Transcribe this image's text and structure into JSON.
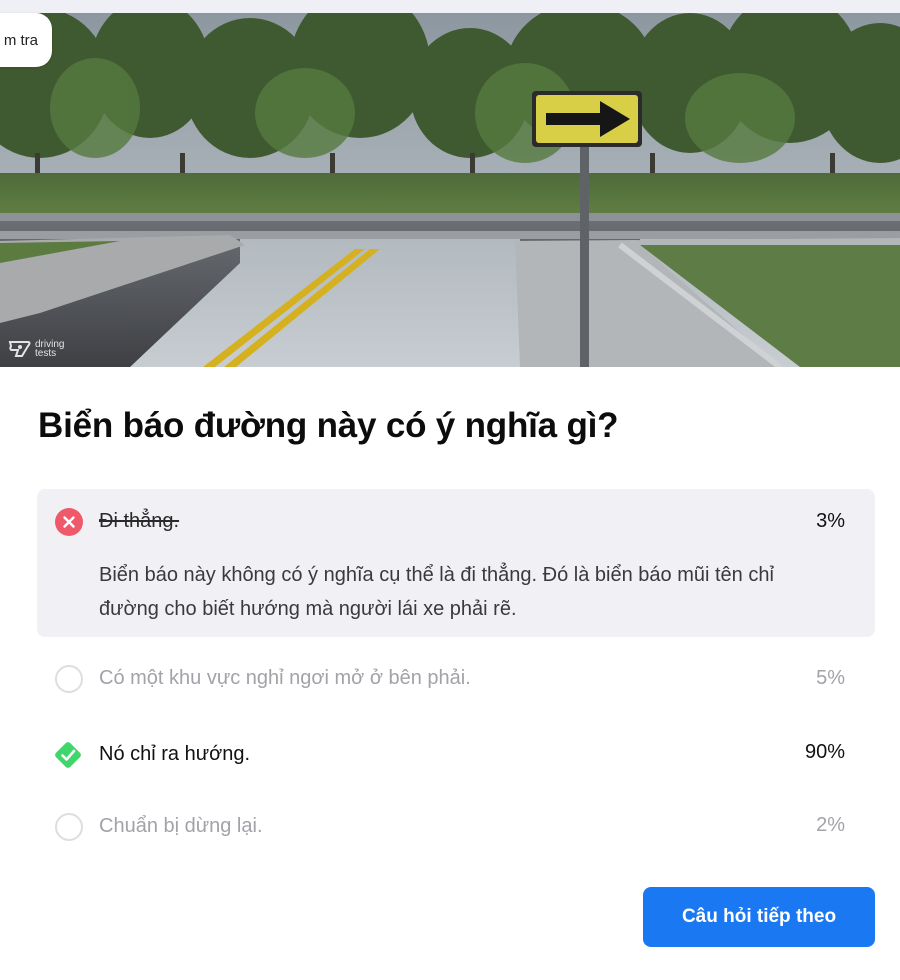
{
  "check_tab": {
    "label": "m tra"
  },
  "watermark": {
    "text": "driving tests"
  },
  "question": {
    "text": "Biển báo đường này có ý nghĩa gì?"
  },
  "answers": [
    {
      "label": "Đi thẳng.",
      "percent": "3%",
      "state": "selected-wrong",
      "explanation": "Biển báo này không có ý nghĩa cụ thể là đi thẳng. Đó là biển báo mũi tên chỉ đường cho biết hướng mà người lái xe phải rẽ."
    },
    {
      "label": "Có một khu vực nghỉ ngơi mở ở bên phải.",
      "percent": "5%",
      "state": "unselected"
    },
    {
      "label": "Nó chỉ ra hướng.",
      "percent": "90%",
      "state": "correct"
    },
    {
      "label": "Chuẩn bị dừng lại.",
      "percent": "2%",
      "state": "unselected"
    }
  ],
  "next_button": {
    "label": "Câu hỏi tiếp theo"
  },
  "colors": {
    "accent": "#1a78f2",
    "wrong": "#ef5a6a",
    "correct": "#3fd66b",
    "selected_bg": "#f1f0f5",
    "muted_text": "#a2a2a8"
  }
}
